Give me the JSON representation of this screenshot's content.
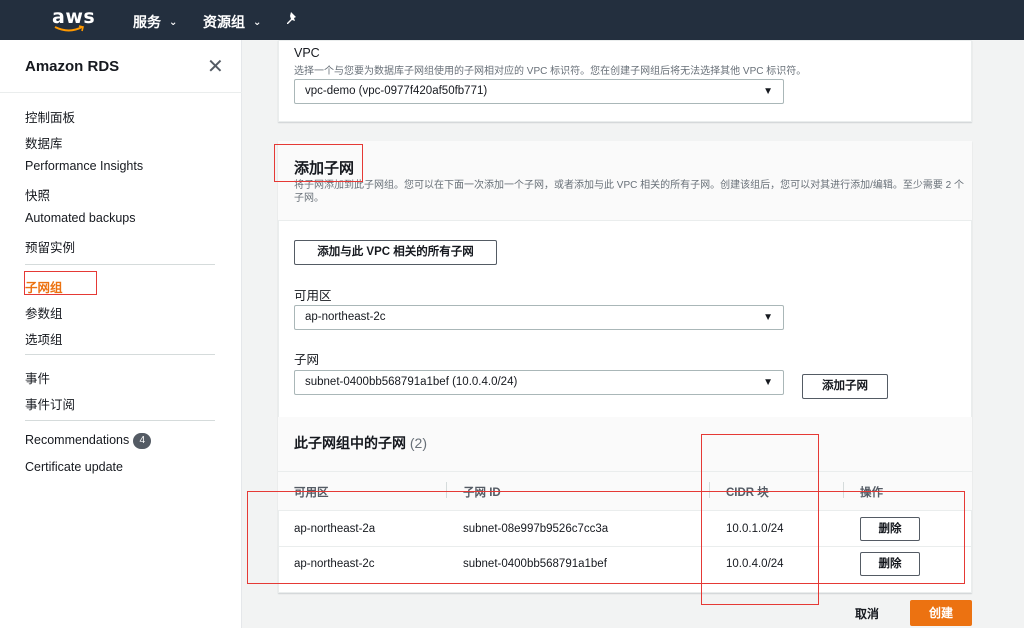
{
  "topnav": {
    "logo_text": "aws",
    "services_label": "服务",
    "resource_groups_label": "资源组",
    "pin_icon": "pin-icon"
  },
  "sidebar": {
    "title": "Amazon RDS",
    "close_icon": "close-icon",
    "group1": [
      "控制面板",
      "数据库",
      "Performance Insights",
      "快照",
      "Automated backups",
      "预留实例"
    ],
    "group2": [
      "子网组",
      "参数组",
      "选项组"
    ],
    "group3": [
      "事件",
      "事件订阅"
    ],
    "group4": [
      "Recommendations",
      "Certificate update"
    ],
    "recommendations_badge": "4",
    "active_item": "子网组"
  },
  "vpc": {
    "label": "VPC",
    "description": "选择一个与您要为数据库子网组使用的子网相对应的 VPC 标识符。您在创建子网组后将无法选择其他 VPC 标识符。",
    "selected": "vpc-demo (vpc-0977f420af50fb771)"
  },
  "add_subnet": {
    "title": "添加子网",
    "description": "将子网添加到此子网组。您可以在下面一次添加一个子网，或者添加与此 VPC 相关的所有子网。创建该组后，您可以对其进行添加/编辑。至少需要 2 个子网。",
    "add_all_button": "添加与此 VPC 相关的所有子网",
    "az_label": "可用区",
    "az_selected": "ap-northeast-2c",
    "subnet_label": "子网",
    "subnet_selected": "subnet-0400bb568791a1bef (10.0.4.0/24)",
    "add_button": "添加子网"
  },
  "subnets_table": {
    "title": "此子网组中的子网",
    "count": "(2)",
    "columns": [
      "可用区",
      "子网 ID",
      "CIDR 块",
      "操作"
    ],
    "rows": [
      {
        "az": "ap-northeast-2a",
        "subnet_id": "subnet-08e997b9526c7cc3a",
        "cidr": "10.0.1.0/24",
        "action": "删除"
      },
      {
        "az": "ap-northeast-2c",
        "subnet_id": "subnet-0400bb568791a1bef",
        "cidr": "10.0.4.0/24",
        "action": "删除"
      }
    ]
  },
  "footer": {
    "cancel_label": "取消",
    "create_label": "创建"
  },
  "colors": {
    "nav_bg": "#232f3e",
    "accent": "#ec7211",
    "annotation_red": "#e53935"
  }
}
